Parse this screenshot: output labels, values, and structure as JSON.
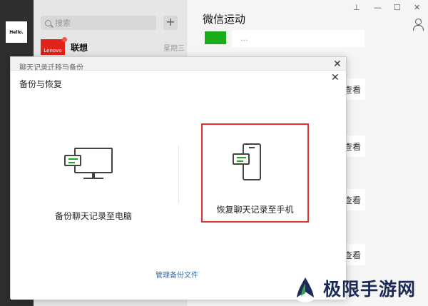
{
  "sidebar": {
    "avatar_text": "Hello."
  },
  "conversation_list": {
    "search_placeholder": "搜索",
    "add_symbol": "+",
    "items": [
      {
        "logo_text": "Lenovo",
        "name": "联想",
        "time": "星期三"
      }
    ]
  },
  "main": {
    "title": "微信运动",
    "window_controls": {
      "pin": "⊥",
      "minimize": "—",
      "maximize": "☐",
      "close": "✕"
    },
    "partial_message": "...",
    "partial_card_text": "查看"
  },
  "dialog": {
    "outer_title": "聊天记录迁移与备份",
    "inner_title": "备份与恢复",
    "close_symbol": "✕",
    "options": [
      {
        "label": "备份聊天记录至电脑"
      },
      {
        "label": "恢复聊天记录至手机"
      }
    ],
    "manage_link": "管理备份文件"
  },
  "watermark": {
    "text": "极限手游网"
  },
  "colors": {
    "accent_green": "#1aad19",
    "highlight_red": "#e0312f",
    "link_blue": "#3a6ea5"
  }
}
